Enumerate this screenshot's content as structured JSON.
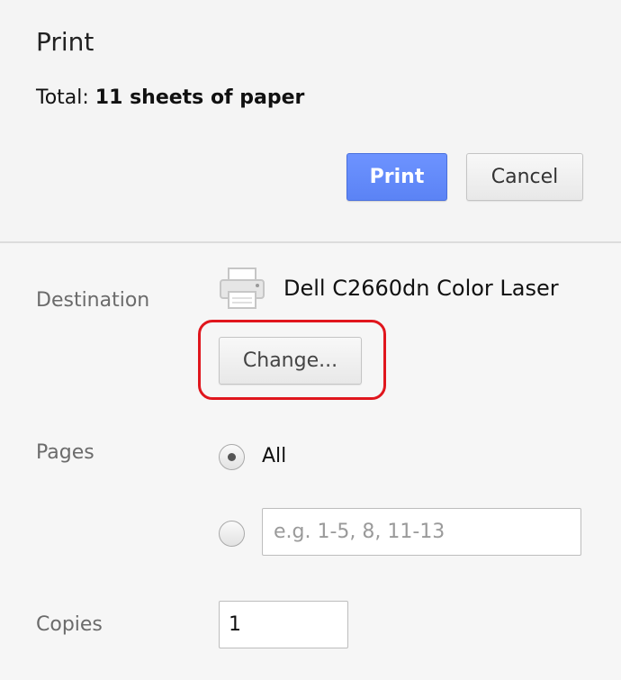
{
  "dialog": {
    "title": "Print",
    "total_label": "Total:",
    "total_value": "11 sheets of paper",
    "print_button": "Print",
    "cancel_button": "Cancel"
  },
  "destination": {
    "label": "Destination",
    "printer_name": "Dell C2660dn Color Laser",
    "change_button": "Change...",
    "icon": "printer-icon"
  },
  "pages": {
    "label": "Pages",
    "all_label": "All",
    "all_selected": true,
    "range_placeholder": "e.g. 1-5, 8, 11-13",
    "range_value": ""
  },
  "copies": {
    "label": "Copies",
    "value": "1"
  },
  "colors": {
    "primary_button": "#5b83f5",
    "highlight": "#e0161d"
  }
}
